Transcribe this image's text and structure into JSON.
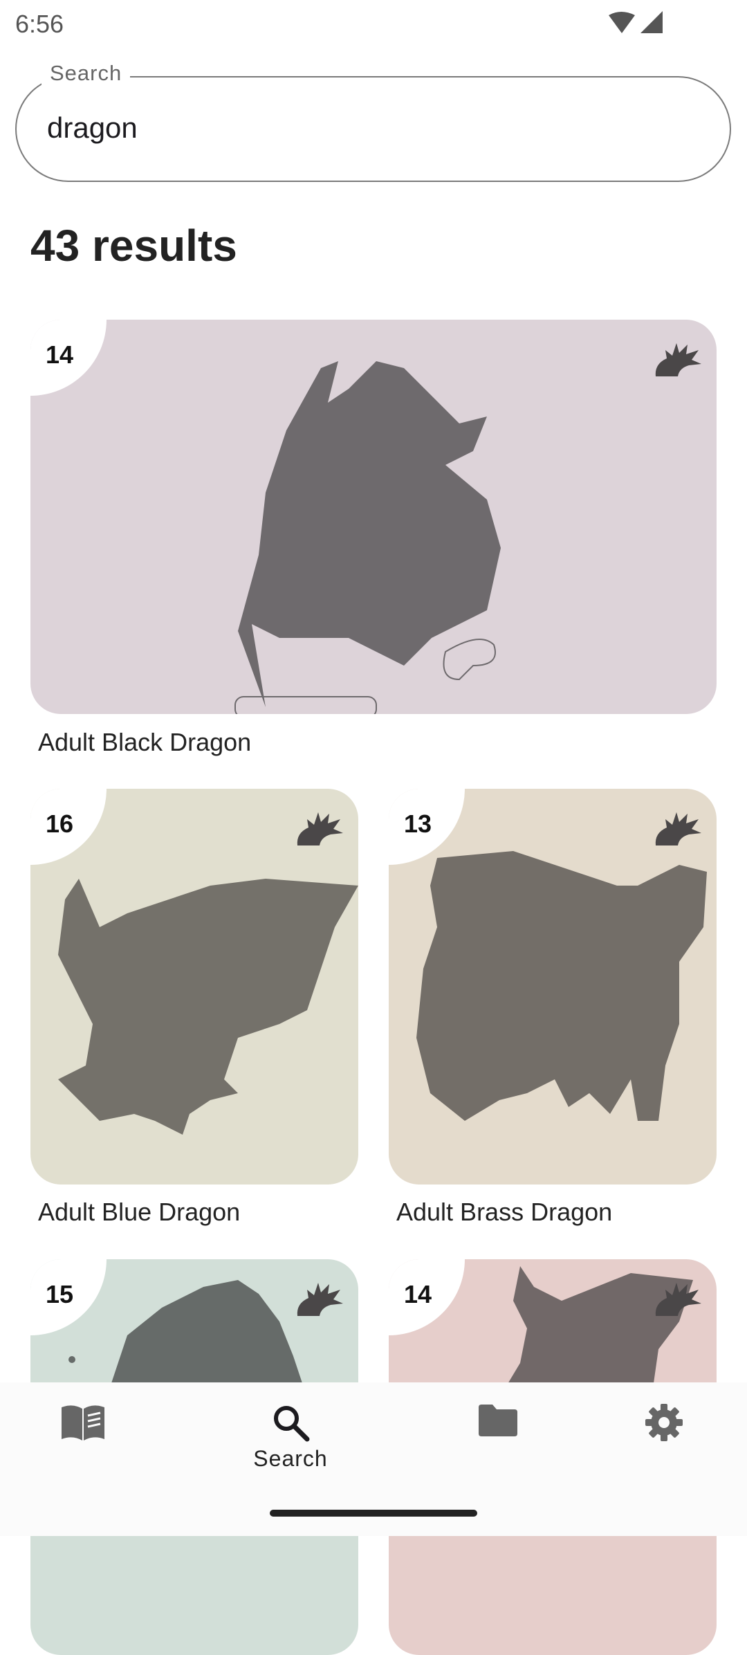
{
  "status_bar": {
    "time": "6:56"
  },
  "search": {
    "label": "Search",
    "value": "dragon"
  },
  "results": {
    "count_label": "43 results",
    "cards": [
      {
        "badge": "14",
        "title": "Adult Black Dragon",
        "bg": "#ddd3d9",
        "fg": "#6e6a6d"
      },
      {
        "badge": "16",
        "title": "Adult Blue Dragon",
        "bg": "#e1dfcf",
        "fg": "#74716a"
      },
      {
        "badge": "13",
        "title": "Adult Brass Dragon",
        "bg": "#e4dbcc",
        "fg": "#736e68"
      },
      {
        "badge": "15",
        "title": "",
        "bg": "#d2dfd8",
        "fg": "#666b69"
      },
      {
        "badge": "14",
        "title": "",
        "bg": "#e6cecb",
        "fg": "#716868"
      }
    ]
  },
  "nav": {
    "items": [
      {
        "icon": "book-icon",
        "label": ""
      },
      {
        "icon": "search-icon",
        "label": "Search"
      },
      {
        "icon": "folder-icon",
        "label": ""
      },
      {
        "icon": "gear-icon",
        "label": ""
      }
    ]
  }
}
